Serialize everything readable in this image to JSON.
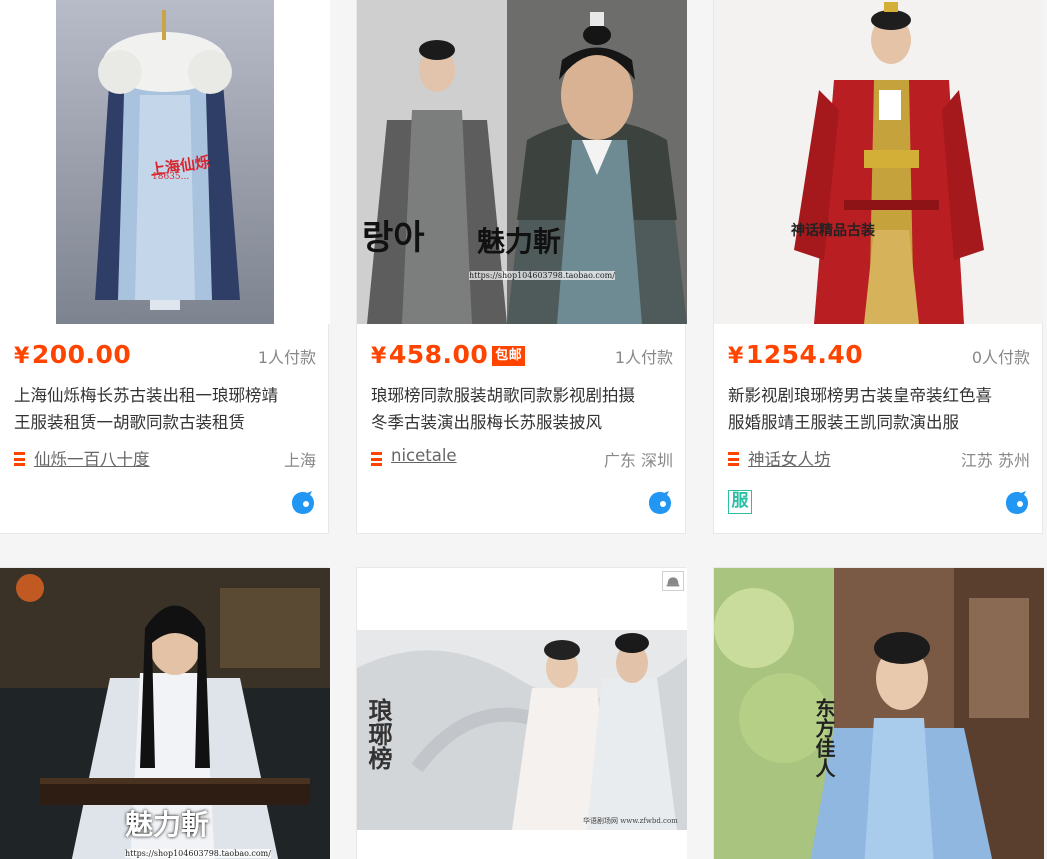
{
  "products": [
    {
      "price": "200.00",
      "currency": "¥",
      "badge": "",
      "paid": "1人付款",
      "title_line1": "上海仙烁梅长苏古装出租一琅琊榜靖",
      "title_line2": "王服装租赁一胡歌同款古装租赁",
      "shop": "仙烁一百八十度",
      "location": "上海",
      "image_icon": "fur-cloak-costume-photo",
      "image_text": "上海仙烁",
      "image_text2": "18635...",
      "service_icon": "wangwang-chat-icon"
    },
    {
      "price": "458.00",
      "currency": "¥",
      "badge": "包邮",
      "paid": "1人付款",
      "title_line1": "琅琊榜同款服装胡歌同款影视剧拍摄",
      "title_line2": "冬季古装演出服梅长苏服装披风",
      "shop": "nicetale",
      "location": "广东 深圳",
      "image_icon": "actor-costume-photo",
      "image_text": "魅力斬",
      "image_text2": "https://shop104603798.taobao.com/",
      "service_icon": "wangwang-chat-icon"
    },
    {
      "price": "1254.40",
      "currency": "¥",
      "badge": "",
      "paid": "0人付款",
      "title_line1": "新影视剧琅琊榜男古装皇帝装红色喜",
      "title_line2": "服婚服靖王服装王凯同款演出服",
      "shop": "神话女人坊",
      "location": "江苏 苏州",
      "image_icon": "red-emperor-costume-photo",
      "image_text": "神话精品古装",
      "service_icon": "wangwang-chat-icon",
      "extra_icon": "服"
    },
    {
      "image_icon": "guqin-player-photo",
      "image_text": "魅力斬",
      "image_text2": "https://shop104603798.taobao.com/"
    },
    {
      "image_icon": "couple-costume-poster",
      "image_text": "琅琊榜",
      "image_text2": "华语剧场网 www.zfwbd.com"
    },
    {
      "image_icon": "blue-costume-actress-photo",
      "image_text": "东方佳人"
    }
  ],
  "colors": {
    "price": "#ff4400",
    "badge_bg": "#ff4400",
    "wangwang": "#2196f3",
    "fu_icon": "#2bbfa4"
  }
}
